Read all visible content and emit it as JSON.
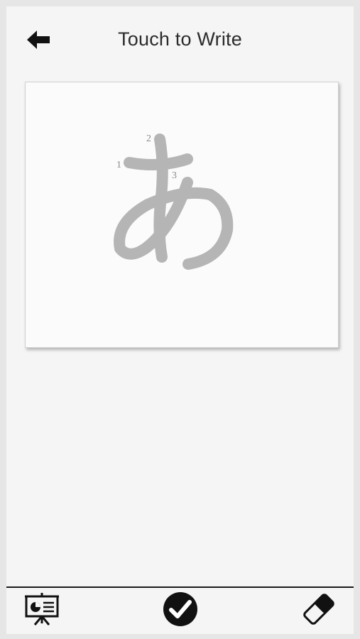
{
  "header": {
    "title": "Touch to Write",
    "back_icon": "arrow-left-icon"
  },
  "writing_canvas": {
    "guide_character": "あ",
    "stroke_numbers": [
      "1",
      "2",
      "3"
    ]
  },
  "toolbar": {
    "items": [
      {
        "icon": "presentation-board-icon"
      },
      {
        "icon": "checkmark-circle-icon"
      },
      {
        "icon": "eraser-icon"
      }
    ]
  },
  "colors": {
    "guide_stroke": "#b5b5b5",
    "toolbar_border": "#1a1a1a",
    "title_text": "#2b2b2b"
  }
}
